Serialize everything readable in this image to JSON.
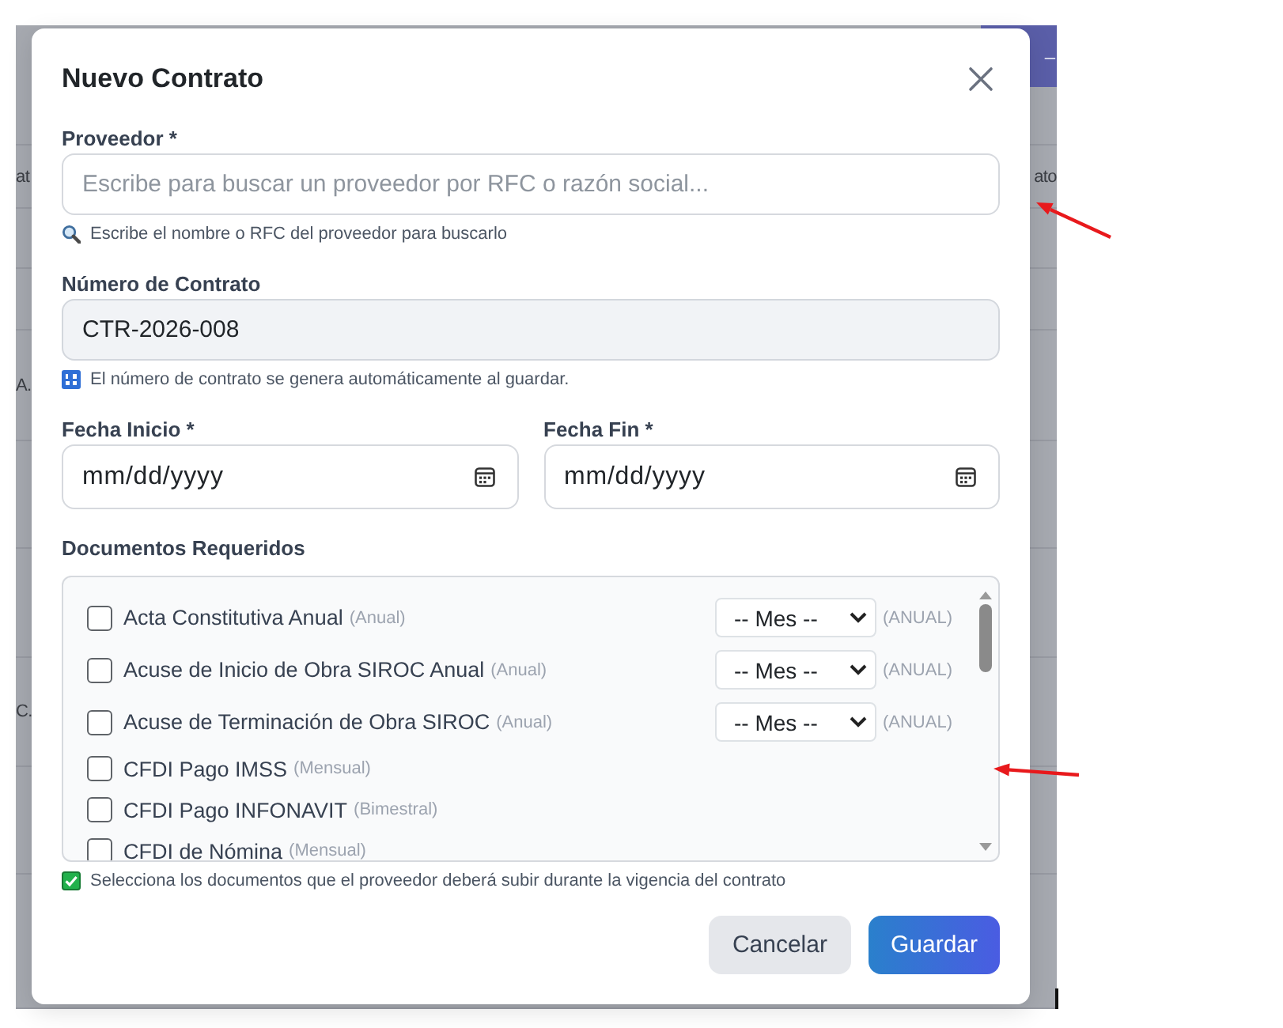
{
  "backdrop": {
    "header_text": "–",
    "row_texts": [
      {
        "left_cell": "at",
        "right_cell": "ato"
      },
      {
        "left_cell": "A."
      },
      {
        "left_cell": "C."
      }
    ]
  },
  "modal": {
    "title": "Nuevo Contrato",
    "provider_field": {
      "label": "Proveedor *",
      "placeholder": "Escribe para buscar un proveedor por RFC o razón social...",
      "hint": "Escribe el nombre o RFC del proveedor para buscarlo"
    },
    "contract_number_field": {
      "label": "Número de Contrato",
      "value": "CTR-2026-008",
      "readonly": true,
      "hint": "El número de contrato se genera automáticamente al guardar."
    },
    "date_fields": [
      {
        "label": "Fecha Inicio *",
        "placeholder": "mm/dd/yyyy"
      },
      {
        "label": "Fecha Fin *",
        "placeholder": "mm/dd/yyyy"
      }
    ],
    "documents": {
      "label": "Documentos Requeridos",
      "items": [
        {
          "kind": "month_select",
          "name": "Acta Constitutiva Anual",
          "frequency": "(Anual)",
          "checked": false,
          "month": "-- Mes --",
          "period": "(ANUAL)"
        },
        {
          "kind": "month_select",
          "name": "Acuse de Inicio de Obra SIROC Anual",
          "frequency": "(Anual)",
          "checked": false,
          "month": "-- Mes --",
          "period": "(ANUAL)"
        },
        {
          "kind": "month_select",
          "name": "Acuse de Terminación de Obra SIROC",
          "frequency": "(Anual)",
          "checked": false,
          "month": "-- Mes --",
          "period": "(ANUAL)"
        },
        {
          "kind": "plain",
          "name": "CFDI Pago IMSS",
          "frequency": "(Mensual)",
          "checked": false
        },
        {
          "kind": "plain",
          "name": "CFDI Pago INFONAVIT",
          "frequency": "(Bimestral)",
          "checked": false
        },
        {
          "kind": "plain",
          "name": "CFDI de Nómina",
          "frequency": "(Mensual)",
          "checked": false
        }
      ],
      "hint": "Selecciona los documentos que el proveedor deberá subir durante la vigencia del contrato"
    },
    "buttons": [
      {
        "kind": "secondary",
        "label": "Cancelar"
      },
      {
        "kind": "primary",
        "label": "Guardar"
      }
    ]
  },
  "annotations": [
    {
      "kind": "arrow"
    },
    {
      "kind": "arrow"
    }
  ]
}
